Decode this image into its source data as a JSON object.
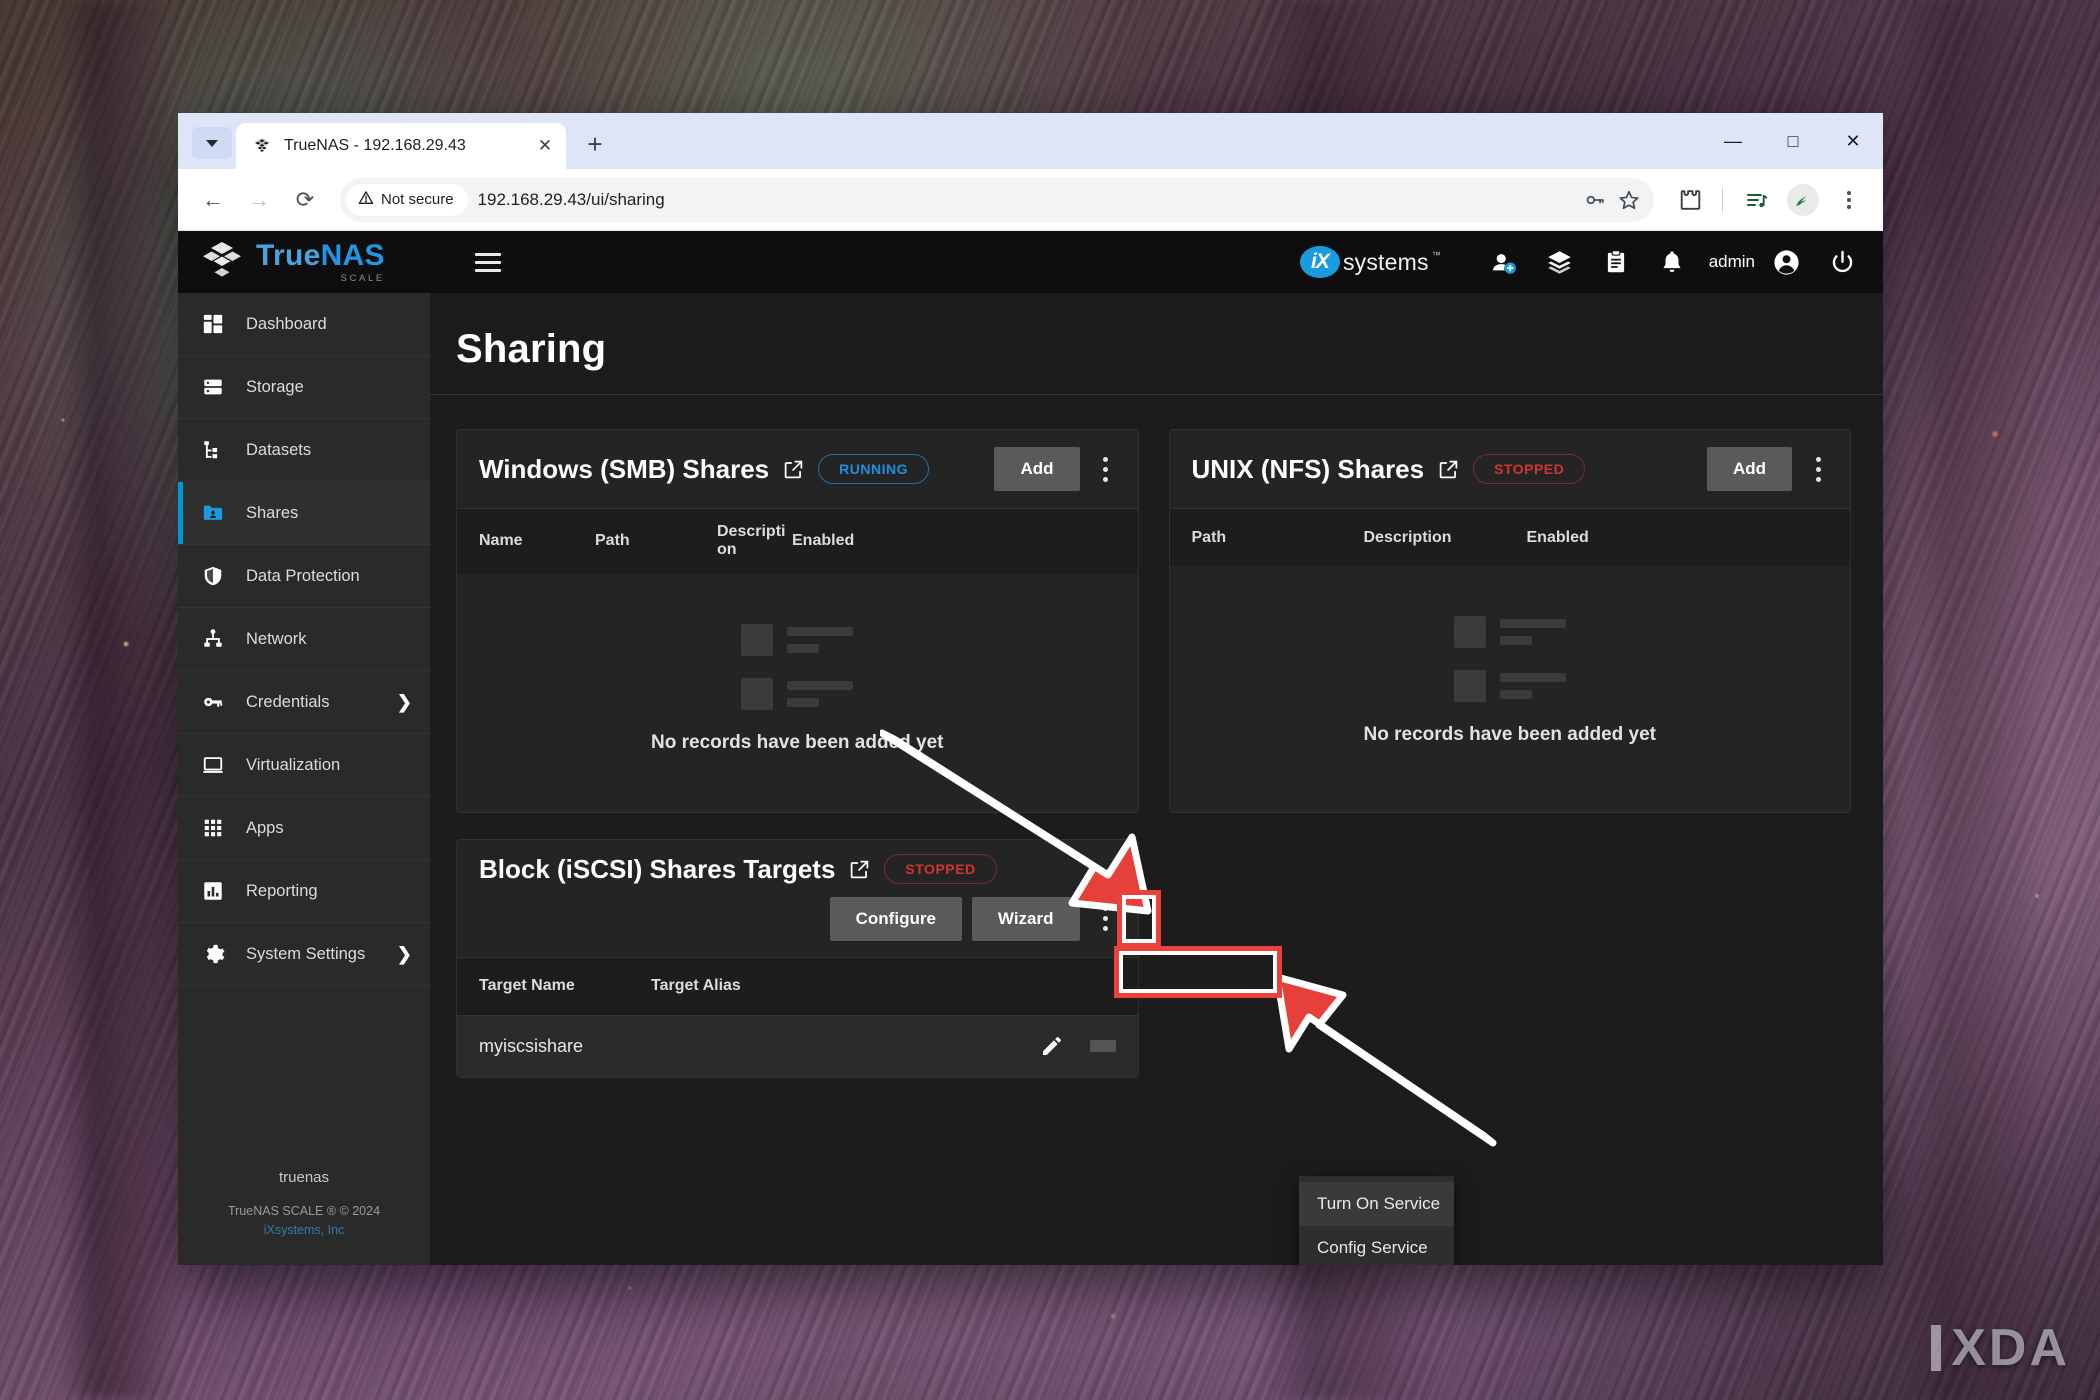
{
  "wallpaper": {
    "name": "painted-forest-wallpaper"
  },
  "watermark": {
    "text": "XDA"
  },
  "browser": {
    "tab": {
      "title": "TrueNAS - 192.168.29.43",
      "favicon": "truenas-cube-icon",
      "close_label": "✕",
      "new_tab_label": "+",
      "tab_list_icon": "chevron-down-icon"
    },
    "window_controls": {
      "minimize": "—",
      "maximize": "□",
      "close": "✕"
    },
    "toolbar": {
      "back": "←",
      "forward": "→",
      "reload": "⟳",
      "security_label": "Not secure",
      "security_icon": "warning-triangle-icon",
      "url": "192.168.29.43/ui/sharing",
      "password_icon": "key-icon",
      "bookmark_icon": "star-icon",
      "extensions_icon": "puzzle-piece-icon",
      "reading_list_icon": "playlist-icon",
      "profile_icon": "profile-avatar-icon",
      "menu_icon": "three-dot-menu-icon"
    }
  },
  "app": {
    "topbar": {
      "logo_main_light": "True",
      "logo_main_bold": "NAS",
      "logo_sub": "SCALE",
      "hamburger_icon": "hamburger-menu-icon",
      "vendor_badge": "iX",
      "vendor_word": "systems",
      "vendor_tm": "™",
      "icons": [
        {
          "name": "add-user-icon",
          "label": ""
        },
        {
          "name": "stack-layers-icon",
          "label": ""
        },
        {
          "name": "clipboard-jobs-icon",
          "label": ""
        },
        {
          "name": "bell-alerts-icon",
          "label": ""
        }
      ],
      "username": "admin",
      "account_icon": "account-circle-icon",
      "power_icon": "power-icon"
    },
    "sidebar": {
      "items": [
        {
          "label": "Dashboard",
          "icon": "dashboard-grid-icon",
          "active": false,
          "expandable": false
        },
        {
          "label": "Storage",
          "icon": "storage-disks-icon",
          "active": false,
          "expandable": false
        },
        {
          "label": "Datasets",
          "icon": "datasets-tree-icon",
          "active": false,
          "expandable": false
        },
        {
          "label": "Shares",
          "icon": "shares-folder-icon",
          "active": true,
          "expandable": false
        },
        {
          "label": "Data Protection",
          "icon": "shield-icon",
          "active": false,
          "expandable": false
        },
        {
          "label": "Network",
          "icon": "network-nodes-icon",
          "active": false,
          "expandable": false
        },
        {
          "label": "Credentials",
          "icon": "key-icon",
          "active": false,
          "expandable": true
        },
        {
          "label": "Virtualization",
          "icon": "monitor-icon",
          "active": false,
          "expandable": false
        },
        {
          "label": "Apps",
          "icon": "apps-grid-icon",
          "active": false,
          "expandable": false
        },
        {
          "label": "Reporting",
          "icon": "bar-chart-icon",
          "active": false,
          "expandable": false
        },
        {
          "label": "System Settings",
          "icon": "gear-icon",
          "active": false,
          "expandable": true
        }
      ],
      "chevron": "❯",
      "footer": {
        "hostname": "truenas",
        "copyright": "TrueNAS SCALE ® © 2024",
        "vendor": "iXsystems, Inc"
      }
    },
    "page": {
      "title": "Sharing"
    },
    "cards": {
      "smb": {
        "title": "Windows (SMB) Shares",
        "external_link_icon": "open-in-new-icon",
        "status": "RUNNING",
        "status_kind": "running",
        "add_label": "Add",
        "kebab_icon": "three-dot-menu-icon",
        "columns": [
          "Name",
          "Path",
          "Description",
          "Enabled"
        ],
        "empty_text": "No records have been added yet"
      },
      "nfs": {
        "title": "UNIX (NFS) Shares",
        "external_link_icon": "open-in-new-icon",
        "status": "STOPPED",
        "status_kind": "stopped",
        "add_label": "Add",
        "kebab_icon": "three-dot-menu-icon",
        "columns": [
          "Path",
          "Description",
          "Enabled"
        ],
        "empty_text": "No records have been added yet"
      },
      "iscsi": {
        "title": "Block (iSCSI) Shares Targets",
        "external_link_icon": "open-in-new-icon",
        "status": "STOPPED",
        "status_kind": "stopped",
        "configure_label": "Configure",
        "wizard_label": "Wizard",
        "kebab_icon": "three-dot-menu-icon",
        "columns": [
          "Target Name",
          "Target Alias"
        ],
        "rows": [
          {
            "target_name": "myiscsishare",
            "target_alias": "",
            "edit_icon": "pencil-edit-icon"
          }
        ]
      }
    },
    "service_menu": {
      "items": [
        {
          "label": "Turn On Service",
          "highlighted": true
        },
        {
          "label": "Config Service",
          "highlighted": false
        }
      ]
    }
  },
  "annotations": {
    "highlight_color": "#e8423a",
    "boxes": [
      {
        "name": "iscsi-kebab-highlight"
      },
      {
        "name": "turn-on-service-highlight"
      }
    ],
    "arrows": [
      {
        "name": "arrow-to-kebab"
      },
      {
        "name": "arrow-to-turn-on-service"
      }
    ]
  }
}
